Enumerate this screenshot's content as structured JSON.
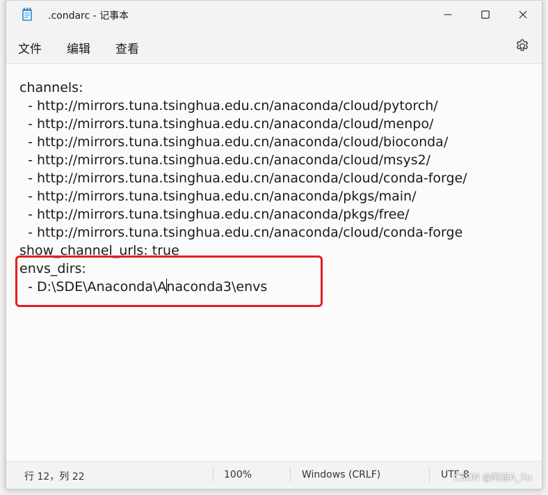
{
  "window": {
    "title": ".condarc - 记事本"
  },
  "menu": {
    "file": "文件",
    "edit": "编辑",
    "view": "查看"
  },
  "editor": {
    "lines": [
      "channels:",
      "  - http://mirrors.tuna.tsinghua.edu.cn/anaconda/cloud/pytorch/",
      "  - http://mirrors.tuna.tsinghua.edu.cn/anaconda/cloud/menpo/",
      "  - http://mirrors.tuna.tsinghua.edu.cn/anaconda/cloud/bioconda/",
      "  - http://mirrors.tuna.tsinghua.edu.cn/anaconda/cloud/msys2/",
      "  - http://mirrors.tuna.tsinghua.edu.cn/anaconda/cloud/conda-forge/",
      "  - http://mirrors.tuna.tsinghua.edu.cn/anaconda/pkgs/main/",
      "  - http://mirrors.tuna.tsinghua.edu.cn/anaconda/pkgs/free/",
      "  - http://mirrors.tuna.tsinghua.edu.cn/anaconda/cloud/conda-forge",
      "show_channel_urls: true",
      "envs_dirs:"
    ],
    "last_line_before_caret": "  - D:\\SDE\\Anaconda\\A",
    "last_line_after_caret": "naconda3\\envs"
  },
  "status": {
    "position": "行 12，列 22",
    "zoom": "100%",
    "line_ending": "Windows (CRLF)",
    "encoding": "UTF-8"
  },
  "watermark": "CSDN @阿旭A_Xu",
  "colors": {
    "highlight_border": "#e02020",
    "window_bg": "#f9f9f9",
    "chrome_bg": "#f3f3f3"
  },
  "icons": {
    "app": "notepad-icon",
    "minimize": "minimize-icon",
    "maximize": "maximize-icon",
    "close": "close-icon",
    "settings": "gear-icon"
  }
}
